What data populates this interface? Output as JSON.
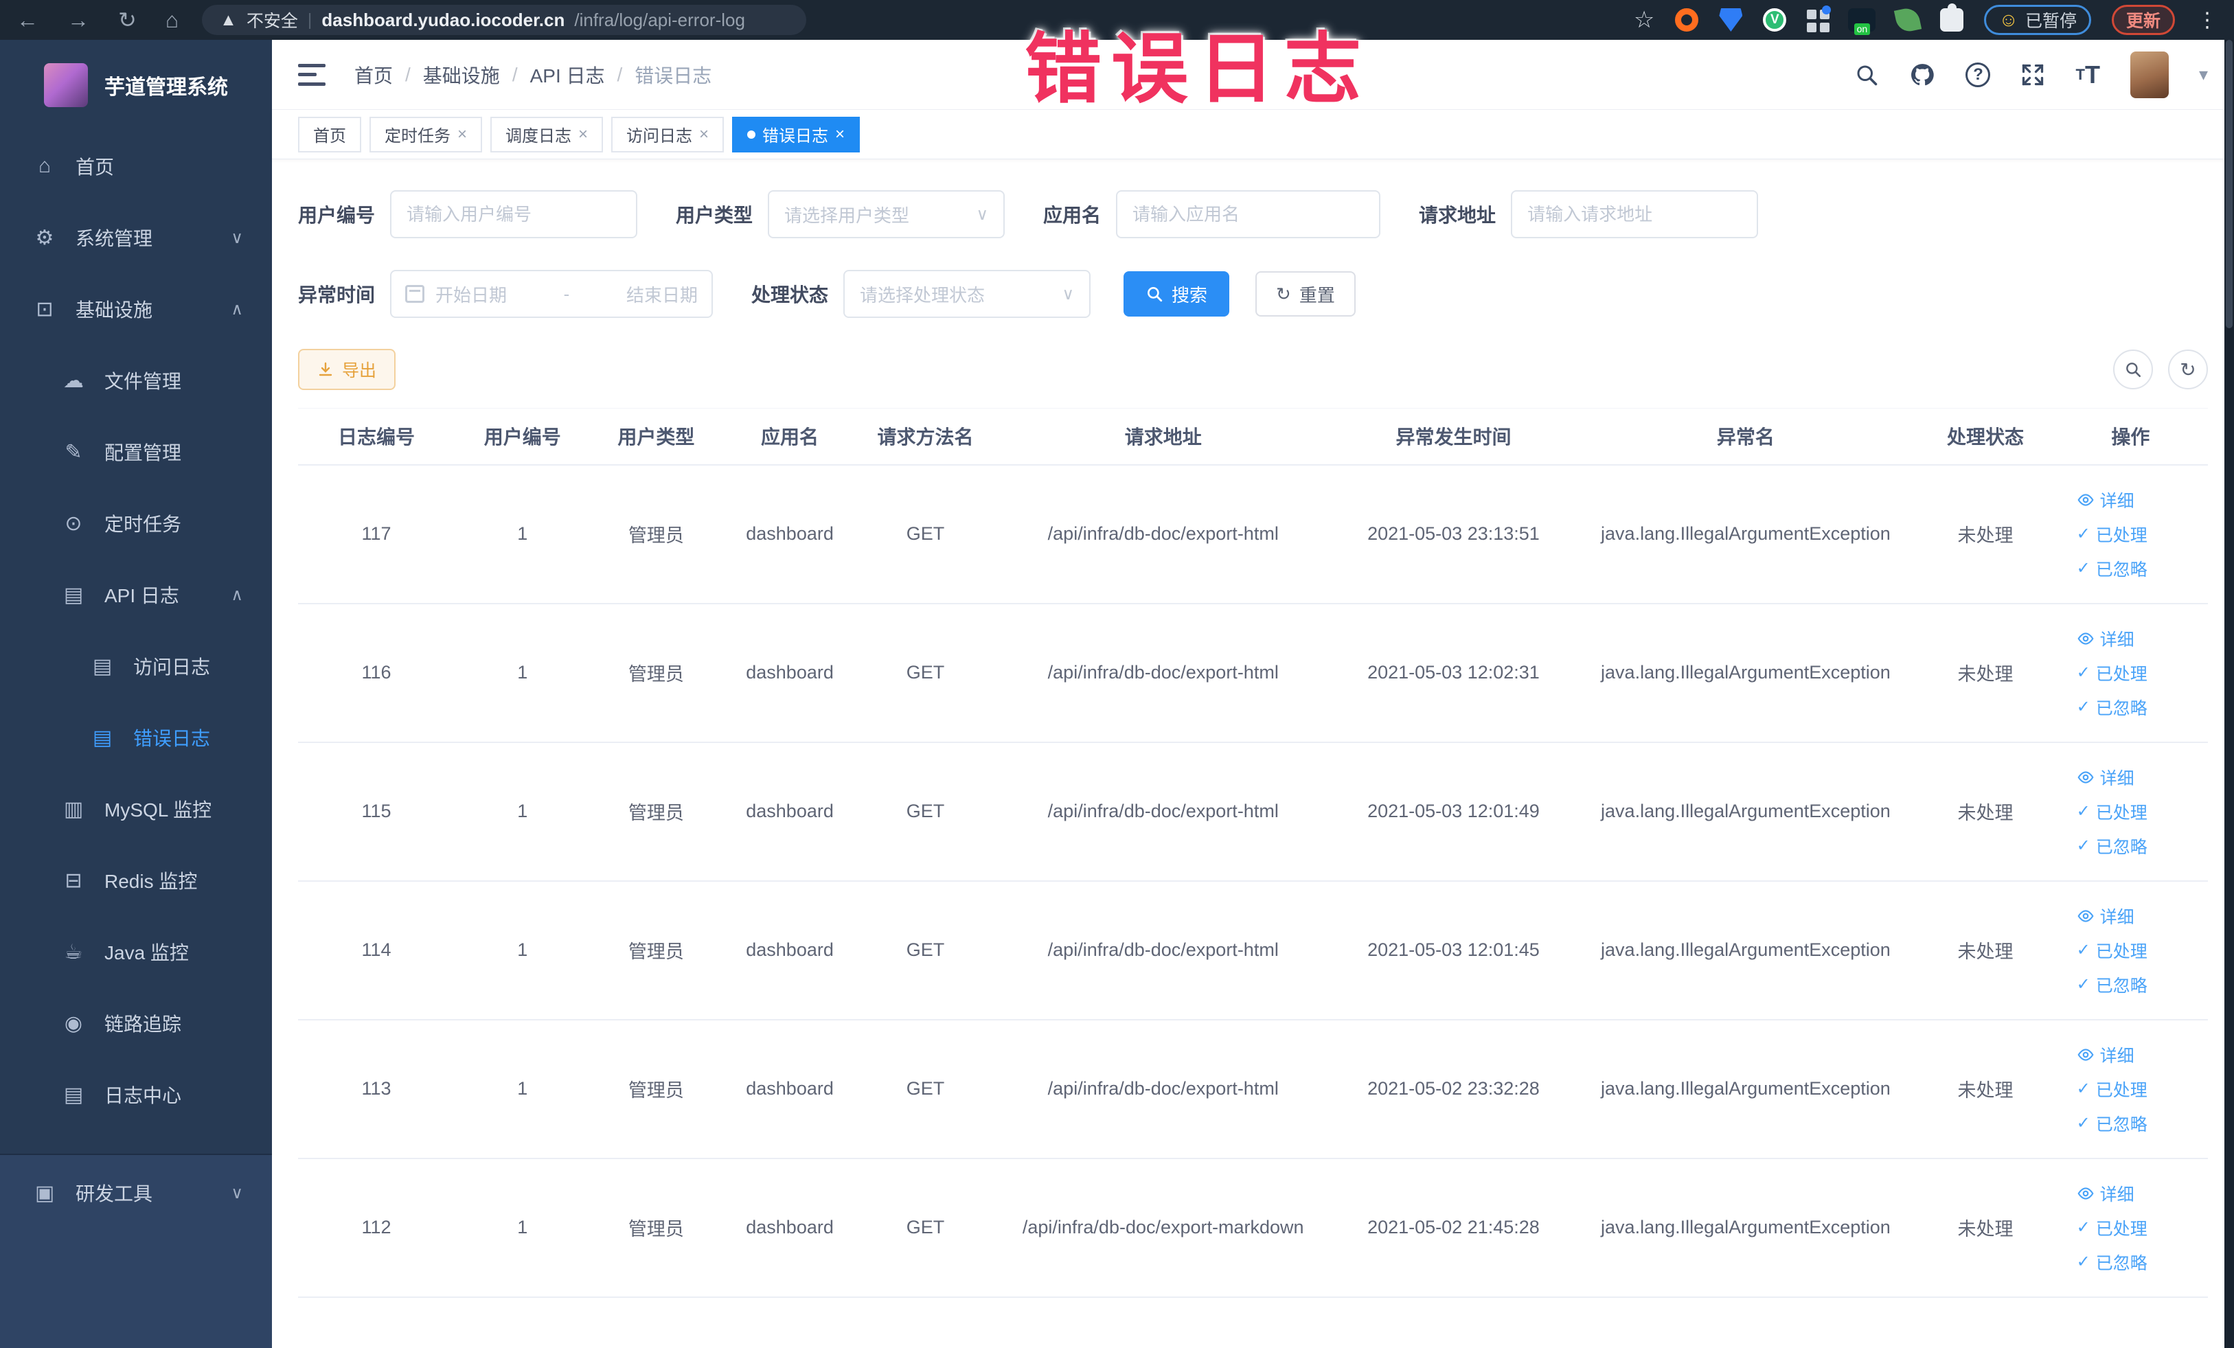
{
  "browser": {
    "security_label": "不安全",
    "url_host": "dashboard.yudao.iocoder.cn",
    "url_path": "/infra/log/api-error-log",
    "extension_on_badge": "on",
    "paused_badge": "已暂停",
    "update_badge": "更新"
  },
  "annotation": {
    "text": "错误日志",
    "color": "#f0325f"
  },
  "sidebar": {
    "title": "芋道管理系统",
    "items": [
      {
        "key": "home",
        "label": "首页",
        "icon": "home-icon",
        "level": 0
      },
      {
        "key": "system",
        "label": "系统管理",
        "icon": "gear-icon",
        "level": 0,
        "chevron": "down"
      },
      {
        "key": "infra",
        "label": "基础设施",
        "icon": "infra-icon",
        "level": 0,
        "chevron": "up"
      },
      {
        "key": "file",
        "label": "文件管理",
        "icon": "file-icon",
        "level": 1
      },
      {
        "key": "config",
        "label": "配置管理",
        "icon": "config-icon",
        "level": 1
      },
      {
        "key": "job",
        "label": "定时任务",
        "icon": "job-icon",
        "level": 1
      },
      {
        "key": "api-log",
        "label": "API 日志",
        "icon": "api-log-icon",
        "level": 1,
        "chevron": "up"
      },
      {
        "key": "access-log",
        "label": "访问日志",
        "icon": "access-log-icon",
        "level": 2
      },
      {
        "key": "error-log",
        "label": "错误日志",
        "icon": "error-log-icon",
        "level": 2,
        "active": true
      },
      {
        "key": "mysql",
        "label": "MySQL 监控",
        "icon": "mysql-icon",
        "level": 1
      },
      {
        "key": "redis",
        "label": "Redis 监控",
        "icon": "redis-icon",
        "level": 1
      },
      {
        "key": "java",
        "label": "Java 监控",
        "icon": "java-icon",
        "level": 1
      },
      {
        "key": "trace",
        "label": "链路追踪",
        "icon": "trace-icon",
        "level": 1
      },
      {
        "key": "log-center",
        "label": "日志中心",
        "icon": "log-center-icon",
        "level": 1
      },
      {
        "key": "devtools",
        "label": "研发工具",
        "icon": "devtools-icon",
        "level": 0,
        "chevron": "down",
        "section": "bottom"
      }
    ]
  },
  "header": {
    "breadcrumb": [
      "首页",
      "基础设施",
      "API 日志",
      "错误日志"
    ],
    "breadcrumb_separator": "/"
  },
  "tags": {
    "items": [
      {
        "key": "home",
        "label": "首页",
        "closable": false,
        "active": false
      },
      {
        "key": "job",
        "label": "定时任务",
        "closable": true,
        "active": false
      },
      {
        "key": "job-log",
        "label": "调度日志",
        "closable": true,
        "active": false
      },
      {
        "key": "access-log",
        "label": "访问日志",
        "closable": true,
        "active": false
      },
      {
        "key": "error-log",
        "label": "错误日志",
        "closable": true,
        "active": true
      }
    ]
  },
  "filters": {
    "user_id": {
      "label": "用户编号",
      "placeholder": "请输入用户编号"
    },
    "user_type": {
      "label": "用户类型",
      "placeholder": "请选择用户类型"
    },
    "app_name": {
      "label": "应用名",
      "placeholder": "请输入应用名"
    },
    "request_url": {
      "label": "请求地址",
      "placeholder": "请输入请求地址"
    },
    "exception_time": {
      "label": "异常时间",
      "start_placeholder": "开始日期",
      "separator": "-",
      "end_placeholder": "结束日期"
    },
    "process_status": {
      "label": "处理状态",
      "placeholder": "请选择处理状态"
    },
    "search_label": "搜索",
    "reset_label": "重置"
  },
  "toolbar": {
    "export_label": "导出"
  },
  "table": {
    "columns": [
      "日志编号",
      "用户编号",
      "用户类型",
      "应用名",
      "请求方法名",
      "请求地址",
      "异常发生时间",
      "异常名",
      "处理状态",
      "操作"
    ],
    "row_actions": [
      "详细",
      "已处理",
      "已忽略"
    ],
    "rows": [
      {
        "log_id": "117",
        "user_id": "1",
        "user_type": "管理员",
        "app_name": "dashboard",
        "method": "GET",
        "request_url": "/api/infra/db-doc/export-html",
        "time": "2021-05-03 23:13:51",
        "exception": "java.lang.IllegalArgumentException",
        "status": "未处理"
      },
      {
        "log_id": "116",
        "user_id": "1",
        "user_type": "管理员",
        "app_name": "dashboard",
        "method": "GET",
        "request_url": "/api/infra/db-doc/export-html",
        "time": "2021-05-03 12:02:31",
        "exception": "java.lang.IllegalArgumentException",
        "status": "未处理"
      },
      {
        "log_id": "115",
        "user_id": "1",
        "user_type": "管理员",
        "app_name": "dashboard",
        "method": "GET",
        "request_url": "/api/infra/db-doc/export-html",
        "time": "2021-05-03 12:01:49",
        "exception": "java.lang.IllegalArgumentException",
        "status": "未处理"
      },
      {
        "log_id": "114",
        "user_id": "1",
        "user_type": "管理员",
        "app_name": "dashboard",
        "method": "GET",
        "request_url": "/api/infra/db-doc/export-html",
        "time": "2021-05-03 12:01:45",
        "exception": "java.lang.IllegalArgumentException",
        "status": "未处理"
      },
      {
        "log_id": "113",
        "user_id": "1",
        "user_type": "管理员",
        "app_name": "dashboard",
        "method": "GET",
        "request_url": "/api/infra/db-doc/export-html",
        "time": "2021-05-02 23:32:28",
        "exception": "java.lang.IllegalArgumentException",
        "status": "未处理"
      },
      {
        "log_id": "112",
        "user_id": "1",
        "user_type": "管理员",
        "app_name": "dashboard",
        "method": "GET",
        "request_url": "/api/infra/db-doc/export-markdown",
        "time": "2021-05-02 21:45:28",
        "exception": "java.lang.IllegalArgumentException",
        "status": "未处理"
      }
    ]
  },
  "colors": {
    "primary": "#2b8ef5",
    "warning": "#e6a23c",
    "sidebar_bg": "#273a54"
  }
}
